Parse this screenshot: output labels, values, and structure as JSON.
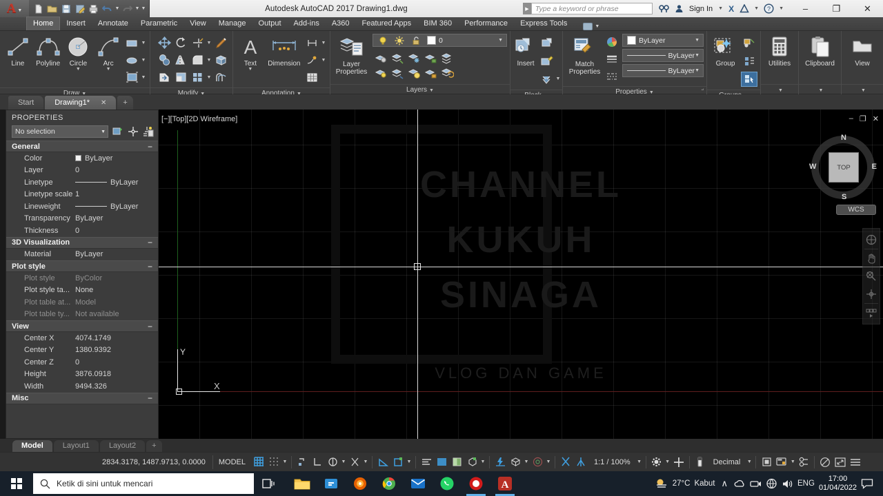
{
  "titlebar": {
    "app_menu_icon": "autocad-a-icon",
    "quick_access": [
      {
        "name": "new-icon",
        "glyph": "⬜"
      },
      {
        "name": "open-icon",
        "glyph": "📂"
      },
      {
        "name": "save-icon",
        "glyph": "💾"
      },
      {
        "name": "saveas-icon",
        "glyph": "🖫"
      },
      {
        "name": "plot-icon",
        "glyph": "🖨"
      },
      {
        "name": "undo-icon",
        "glyph": "↩"
      },
      {
        "name": "redo-icon",
        "glyph": "↪"
      },
      {
        "name": "qat-dropdown-icon",
        "glyph": "▼"
      }
    ],
    "title": "Autodesk AutoCAD 2017  Drawing1.dwg",
    "search_placeholder": "Type a keyword or phrase",
    "sign_in": "Sign In",
    "icons": [
      "search-net-icon",
      "user-icon",
      "exchange-x-icon",
      "autodesk-a360-icon",
      "help-icon"
    ],
    "window_controls": {
      "minimize": "–",
      "maximize": "❐",
      "close": "✕"
    }
  },
  "ribbon_tabs": [
    {
      "label": "Home",
      "active": true
    },
    {
      "label": "Insert",
      "active": false
    },
    {
      "label": "Annotate",
      "active": false
    },
    {
      "label": "Parametric",
      "active": false
    },
    {
      "label": "View",
      "active": false
    },
    {
      "label": "Manage",
      "active": false
    },
    {
      "label": "Output",
      "active": false
    },
    {
      "label": "Add-ins",
      "active": false
    },
    {
      "label": "A360",
      "active": false
    },
    {
      "label": "Featured Apps",
      "active": false
    },
    {
      "label": "BIM 360",
      "active": false
    },
    {
      "label": "Performance",
      "active": false
    },
    {
      "label": "Express Tools",
      "active": false
    }
  ],
  "ribbon_panels": {
    "draw": {
      "title": "Draw",
      "big_buttons": [
        {
          "label": "Line",
          "icon": "line-icon",
          "has_dropdown": false
        },
        {
          "label": "Polyline",
          "icon": "polyline-icon",
          "has_dropdown": false
        },
        {
          "label": "Circle",
          "icon": "circle-icon",
          "has_dropdown": true
        },
        {
          "label": "Arc",
          "icon": "arc-icon",
          "has_dropdown": true
        }
      ],
      "small_buttons": [
        {
          "icon": "rectangle-icon",
          "has_dropdown": true
        },
        {
          "icon": "ellipse-icon",
          "has_dropdown": true
        },
        {
          "icon": "hatch-icon",
          "has_dropdown": true
        }
      ]
    },
    "modify": {
      "title": "Modify",
      "small_buttons": [
        {
          "icon": "move-icon"
        },
        {
          "icon": "rotate-icon"
        },
        {
          "icon": "trim-icon",
          "has_dropdown": true
        },
        {
          "icon": "erase-brush-icon"
        },
        {
          "icon": "copy-icon"
        },
        {
          "icon": "mirror-icon"
        },
        {
          "icon": "fillet-icon",
          "has_dropdown": true
        },
        {
          "icon": "3dsolid-icon"
        },
        {
          "icon": "stretch-icon"
        },
        {
          "icon": "scale-icon"
        },
        {
          "icon": "array-icon",
          "has_dropdown": true
        },
        {
          "icon": "offset-icon"
        }
      ]
    },
    "annotation": {
      "title": "Annotation",
      "big_buttons": [
        {
          "label": "Text",
          "icon": "text-icon",
          "has_dropdown": true
        },
        {
          "label": "Dimension",
          "icon": "dimension-icon",
          "has_dropdown": false
        }
      ],
      "small_buttons": [
        {
          "icon": "dim-style-icon",
          "has_dropdown": true
        },
        {
          "icon": "leader-icon",
          "has_dropdown": true
        },
        {
          "icon": "table-icon"
        }
      ]
    },
    "layers": {
      "title": "Layers",
      "big_button": {
        "label_line1": "Layer",
        "label_line2": "Properties",
        "icon": "layer-properties-icon"
      },
      "layer_combo": {
        "value": "0",
        "icons": [
          "lightbulb-icon",
          "sun-icon",
          "unlock-icon"
        ],
        "color_swatch": "#ffffff"
      },
      "small_buttons": [
        {
          "icon": "layer-isolate-icon"
        },
        {
          "icon": "layer-freeze-icon"
        },
        {
          "icon": "layer-off-icon"
        },
        {
          "icon": "layer-lock-icon"
        },
        {
          "icon": "layer-merge-icon"
        },
        {
          "icon": "layer-unisolate-icon"
        },
        {
          "icon": "layer-match-icon"
        },
        {
          "icon": "layer-on-icon"
        },
        {
          "icon": "layer-unlock-icon"
        },
        {
          "icon": "layer-previous-icon"
        }
      ]
    },
    "block": {
      "title": "Block",
      "big_button": {
        "label": "Insert",
        "icon": "insert-block-icon"
      },
      "small_buttons": [
        {
          "icon": "create-block-icon"
        },
        {
          "icon": "edit-block-icon"
        },
        {
          "icon": "block-editor-icon",
          "has_dropdown": true
        }
      ]
    },
    "properties": {
      "title": "Properties",
      "match_properties": {
        "label_line1": "Match",
        "label_line2": "Properties",
        "icon": "match-properties-icon"
      },
      "side_icons": [
        "color-wheel-icon",
        "lineweight-list-icon",
        "linetype-list-icon"
      ],
      "combos": [
        {
          "name": "object-color-combo",
          "value": "ByLayer",
          "type": "swatch"
        },
        {
          "name": "lineweight-combo",
          "value": "ByLayer",
          "type": "line"
        },
        {
          "name": "linetype-combo",
          "value": "ByLayer",
          "type": "line"
        }
      ]
    },
    "groups": {
      "title": "Groups",
      "big_button": {
        "label": "Group",
        "icon": "group-icon"
      },
      "small_buttons": [
        {
          "icon": "ungroup-icon"
        },
        {
          "icon": "group-edit-icon"
        },
        {
          "icon": "group-selection-icon"
        }
      ]
    },
    "utilities": {
      "title": "",
      "big_button": {
        "label": "Utilities",
        "icon": "calculator-icon"
      }
    },
    "clipboard": {
      "title": "",
      "big_button": {
        "label": "Clipboard",
        "icon": "clipboard-icon"
      }
    },
    "view": {
      "title": "",
      "big_button": {
        "label": "View",
        "icon": "view-icon"
      }
    }
  },
  "file_tabs": [
    {
      "label": "Start",
      "active": false,
      "closable": false
    },
    {
      "label": "Drawing1*",
      "active": true,
      "closable": true
    },
    {
      "label": "+",
      "active": false,
      "closable": false
    }
  ],
  "properties_palette": {
    "header": "PROPERTIES",
    "selection": "No selection",
    "tool_icons": [
      "quick-select-icon",
      "select-objects-icon",
      "quick-calc-icon"
    ],
    "groups": [
      {
        "name": "General",
        "collapse_glyph": "−",
        "rows": [
          {
            "key": "Color",
            "value": "ByLayer",
            "type": "swatch",
            "dim": false
          },
          {
            "key": "Layer",
            "value": "0",
            "type": "text",
            "dim": false
          },
          {
            "key": "Linetype",
            "value": "ByLayer",
            "type": "line",
            "dim": false
          },
          {
            "key": "Linetype scale",
            "value": "1",
            "type": "text",
            "dim": false
          },
          {
            "key": "Lineweight",
            "value": "ByLayer",
            "type": "line",
            "dim": false
          },
          {
            "key": "Transparency",
            "value": "ByLayer",
            "type": "text",
            "dim": false
          },
          {
            "key": "Thickness",
            "value": "0",
            "type": "text",
            "dim": false
          }
        ]
      },
      {
        "name": "3D Visualization",
        "collapse_glyph": "−",
        "rows": [
          {
            "key": "Material",
            "value": "ByLayer",
            "type": "text",
            "dim": false
          }
        ]
      },
      {
        "name": "Plot style",
        "collapse_glyph": "−",
        "rows": [
          {
            "key": "Plot style",
            "value": "ByColor",
            "type": "text",
            "dim": true
          },
          {
            "key": "Plot style ta...",
            "value": "None",
            "type": "text",
            "dim": false
          },
          {
            "key": "Plot table at...",
            "value": "Model",
            "type": "text",
            "dim": true
          },
          {
            "key": "Plot table ty...",
            "value": "Not available",
            "type": "text",
            "dim": true
          }
        ]
      },
      {
        "name": "View",
        "collapse_glyph": "−",
        "rows": [
          {
            "key": "Center X",
            "value": "4074.1749",
            "type": "text",
            "dim": false
          },
          {
            "key": "Center Y",
            "value": "1380.9392",
            "type": "text",
            "dim": false
          },
          {
            "key": "Center Z",
            "value": "0",
            "type": "text",
            "dim": false
          },
          {
            "key": "Height",
            "value": "3876.0918",
            "type": "text",
            "dim": false
          },
          {
            "key": "Width",
            "value": "9494.326",
            "type": "text",
            "dim": false
          }
        ]
      },
      {
        "name": "Misc",
        "collapse_glyph": "−",
        "rows": []
      }
    ]
  },
  "canvas": {
    "viewport_label": "[−][Top][2D Wireframe]",
    "viewport_controls": {
      "minimize": "–",
      "restore": "❐",
      "close": "✕"
    },
    "watermark": {
      "line1": "CHANNEL",
      "line2": "KUKUH",
      "line3": "SINAGA",
      "line4": "VLOG DAN GAME"
    },
    "ucs": {
      "x_label": "X",
      "y_label": "Y"
    },
    "viewcube": {
      "face": "TOP",
      "north": "N",
      "south": "S",
      "west": "W",
      "east": "E",
      "wcs": "WCS"
    },
    "navbar_icons": [
      "steering-wheel-icon",
      "pan-icon",
      "zoom-icon",
      "orbit-icon",
      "showmotion-icon"
    ]
  },
  "layout_tabs": [
    {
      "label": "Model",
      "active": true
    },
    {
      "label": "Layout1",
      "active": false
    },
    {
      "label": "Layout2",
      "active": false
    },
    {
      "label": "+",
      "active": false
    }
  ],
  "statusbar": {
    "coordinates": "2834.3178, 1487.9713, 0.0000",
    "space": "MODEL",
    "scale": "1:1 / 100%",
    "units": "Decimal",
    "toggles": [
      {
        "name": "grid-display-toggle",
        "glyph": "▦",
        "on": true
      },
      {
        "name": "snap-mode-toggle",
        "glyph": "∷",
        "on": false,
        "has_dropdown": true
      },
      {
        "name": "infer-constraints-toggle",
        "glyph": "⌐",
        "on": false
      },
      {
        "name": "dynamic-ucs-toggle",
        "glyph": "∟",
        "on": false
      },
      {
        "name": "ortho-mode-toggle",
        "glyph": "◔",
        "on": false,
        "has_dropdown": true
      },
      {
        "name": "polar-tracking-toggle",
        "glyph": "✕",
        "on": false,
        "has_dropdown": true
      },
      {
        "name": "object-snap-toggle",
        "glyph": "∠",
        "on": true
      },
      {
        "name": "3d-object-snap-toggle",
        "glyph": "⬚",
        "on": true,
        "has_dropdown": true
      },
      {
        "name": "object-snap-tracking-toggle",
        "glyph": "≡",
        "on": false
      },
      {
        "name": "lineweight-toggle",
        "glyph": "▒",
        "on": true
      },
      {
        "name": "transparency-toggle",
        "glyph": "◧",
        "on": false
      },
      {
        "name": "selection-cycling-toggle",
        "glyph": "⬡",
        "on": false,
        "has_dropdown": true
      },
      {
        "name": "dynamic-input-toggle",
        "glyph": "⚡",
        "on": true
      },
      {
        "name": "3d-workspace-toggle",
        "glyph": "⬚",
        "on": false,
        "has_dropdown": true
      },
      {
        "name": "annotation-visibility-toggle",
        "glyph": "◎",
        "on": false,
        "has_dropdown": true
      },
      {
        "name": "annotation-scale-auto-toggle",
        "glyph": "⚔",
        "on": true
      },
      {
        "name": "annotation-scale-add-toggle",
        "glyph": "⑂",
        "on": true
      }
    ],
    "right_icons": [
      {
        "name": "workspace-switch-icon",
        "glyph": "⚙",
        "has_dropdown": true
      },
      {
        "name": "hardware-accel-icon",
        "glyph": "＋"
      },
      {
        "name": "isolate-objects-icon",
        "glyph": "▯"
      },
      {
        "name": "units-dropdown-icon",
        "glyph": "▾"
      },
      {
        "name": "viewport-config-icon",
        "glyph": "▣"
      },
      {
        "name": "graphics-perf-icon",
        "glyph": "⬚",
        "has_dropdown": true
      },
      {
        "name": "clean-screen-icon",
        "glyph": "⚉"
      },
      {
        "name": "lock-ui-icon",
        "glyph": "◌"
      },
      {
        "name": "fullscreen-icon",
        "glyph": "⬌"
      },
      {
        "name": "customization-icon",
        "glyph": "≡"
      }
    ]
  },
  "taskbar": {
    "start_icon": "windows-start-icon",
    "search_placeholder": "Ketik di sini untuk mencari",
    "search_icon": "search-icon",
    "taskview_icon": "task-view-icon",
    "apps": [
      {
        "name": "file-explorer-icon",
        "glyph": "📁",
        "color": "#f5c349",
        "active": false
      },
      {
        "name": "microsoft-store-icon",
        "glyph": "⊞",
        "color": "#2e8fd6",
        "active": false
      },
      {
        "name": "firefox-icon",
        "glyph": "◉",
        "color": "#e66000",
        "active": false
      },
      {
        "name": "chrome-icon",
        "glyph": "◉",
        "color": "#3e8f3e",
        "active": false
      },
      {
        "name": "mail-icon",
        "glyph": "✉",
        "color": "#1a72c8",
        "active": false
      },
      {
        "name": "whatsapp-icon",
        "glyph": "✆",
        "color": "#25d366",
        "active": false
      },
      {
        "name": "recorder-icon",
        "glyph": "●",
        "color": "#d21b1b",
        "active": true
      },
      {
        "name": "autocad-icon",
        "glyph": "A",
        "color": "#b82f25",
        "active": true
      }
    ],
    "tray": {
      "weather_icon": "weather-fog-icon",
      "temperature": "27°C",
      "weather_text": "Kabut",
      "chevron": "∧",
      "icons": [
        {
          "name": "onedrive-icon",
          "glyph": "☁"
        },
        {
          "name": "usb-device-icon",
          "glyph": "⌨"
        },
        {
          "name": "network-icon",
          "glyph": "🌐"
        },
        {
          "name": "volume-icon",
          "glyph": "🔊"
        }
      ],
      "language": "ENG",
      "time": "17:00",
      "date": "01/04/2022",
      "notification_icon": "notification-icon"
    }
  },
  "colors": {
    "accent_blue": "#3f9fe0",
    "autodesk_red": "#c0392b",
    "ribbon_bg": "#3c3c3c",
    "canvas_bg": "#000000",
    "taskbar_bg": "#17202a"
  }
}
